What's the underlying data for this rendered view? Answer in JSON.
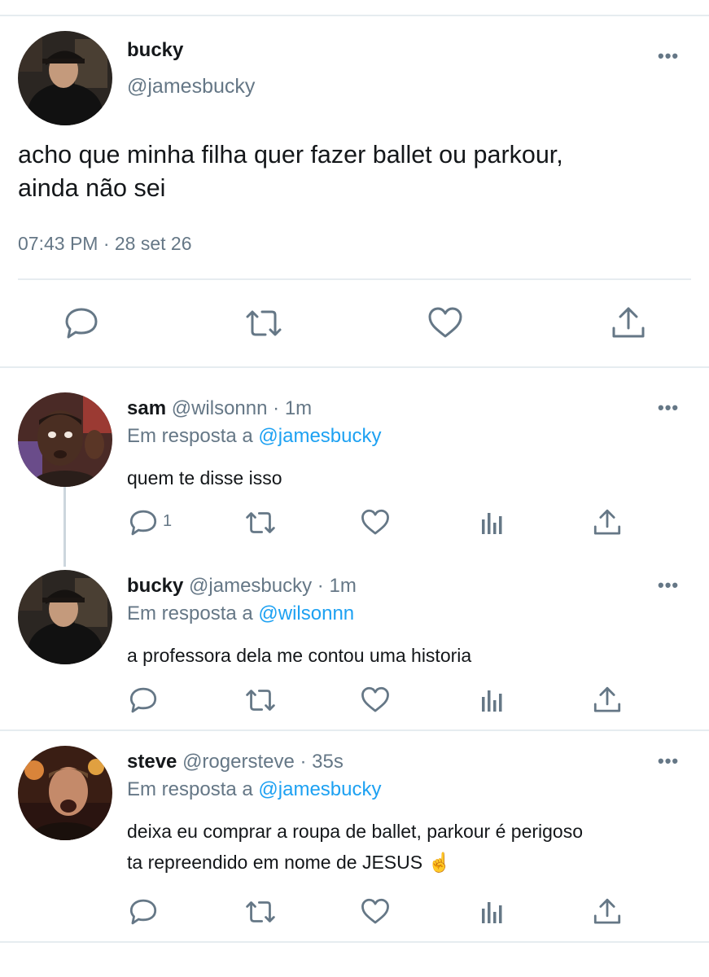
{
  "main_tweet": {
    "name": "bucky",
    "handle": "@jamesbucky",
    "text_line1": "acho que minha filha quer fazer ballet ou parkour,",
    "text_line2": "ainda não sei",
    "timestamp": "07:43 PM · 28 set 26",
    "icons": [
      "comment-icon",
      "retweet-icon",
      "like-icon",
      "share-icon"
    ]
  },
  "replies": [
    {
      "name": "sam",
      "handle": "@wilsonnn",
      "dot": "·",
      "time": "1m",
      "in_reply_prefix": "Em resposta a",
      "in_reply_to": "@jamesbucky",
      "text_line1": "quem te disse isso",
      "reply_count": "1"
    },
    {
      "name": "bucky",
      "handle": "@jamesbucky",
      "dot": "·",
      "time": "1m",
      "in_reply_prefix": "Em resposta a",
      "in_reply_to": "@wilsonnn",
      "text_line1": "a professora dela me contou uma historia"
    },
    {
      "name": "steve",
      "handle": "@rogersteve",
      "dot": "·",
      "time": "35s",
      "in_reply_prefix": "Em resposta a",
      "in_reply_to": "@jamesbucky",
      "text_line1": "deixa eu comprar a roupa de ballet, parkour é perigoso",
      "text_line2": "ta repreendido em nome de JESUS ☝️"
    }
  ],
  "more_label": "•••",
  "colors": {
    "text": "#14171a",
    "secondary": "#657786",
    "link": "#1da1f2",
    "divider": "#e6ecf0"
  }
}
